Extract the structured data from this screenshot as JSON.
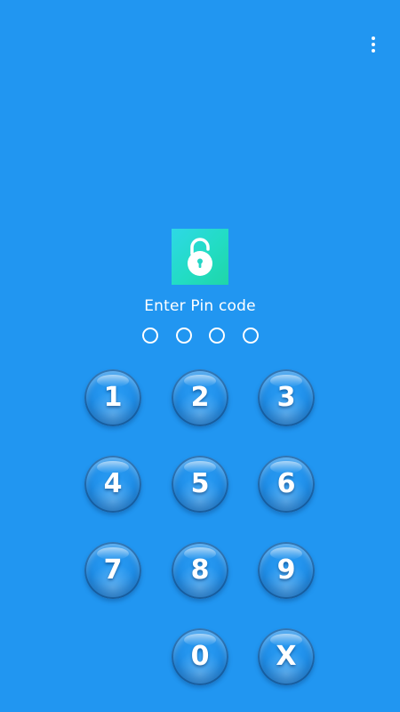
{
  "header": {
    "menu_icon": "more-vertical-icon"
  },
  "lock": {
    "icon": "padlock-icon",
    "icon_colors": {
      "gradient_start": "#2ed8e6",
      "gradient_end": "#1fd6a8",
      "lock_body": "#ffffff"
    },
    "prompt": "Enter Pin code",
    "pin_length": 4,
    "entered_digits": 0
  },
  "keypad": {
    "keys": [
      {
        "label": "1"
      },
      {
        "label": "2"
      },
      {
        "label": "3"
      },
      {
        "label": "4"
      },
      {
        "label": "5"
      },
      {
        "label": "6"
      },
      {
        "label": "7"
      },
      {
        "label": "8"
      },
      {
        "label": "9"
      },
      {
        "label": "0"
      },
      {
        "label": "X"
      }
    ]
  },
  "colors": {
    "background": "#2196f1",
    "key_fill": "#1f8fe9",
    "text": "#ffffff"
  }
}
